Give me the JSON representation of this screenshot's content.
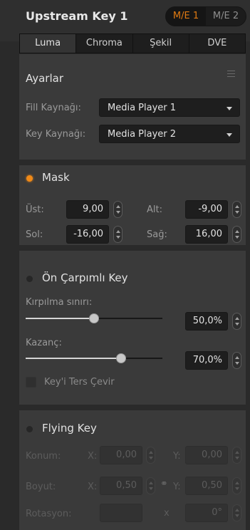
{
  "header": {
    "title": "Upstream Key 1",
    "me_buttons": [
      {
        "label": "M/E 1",
        "active": true
      },
      {
        "label": "M/E 2",
        "active": false
      }
    ]
  },
  "tabs": [
    "Luma",
    "Chroma",
    "Şekil",
    "DVE"
  ],
  "active_tab": "Luma",
  "settings": {
    "heading": "Ayarlar",
    "fill_label": "Fill Kaynağı:",
    "fill_value": "Media Player 1",
    "key_label": "Key Kaynağı:",
    "key_value": "Media Player 2"
  },
  "mask": {
    "heading": "Mask",
    "enabled": true,
    "top_label": "Üst:",
    "top_value": "9,00",
    "bottom_label": "Alt:",
    "bottom_value": "-9,00",
    "left_label": "Sol:",
    "left_value": "-16,00",
    "right_label": "Sağ:",
    "right_value": "16,00"
  },
  "premultiplied": {
    "heading": "Ön Çarpımlı Key",
    "enabled": false,
    "clip_label": "Kırpılma sınırı:",
    "clip_value": "50,0%",
    "clip_level": 0.5,
    "gain_label": "Kazanç:",
    "gain_value": "70,0%",
    "gain_level": 0.7,
    "invert_label": "Key'i Ters Çevir",
    "invert_checked": false
  },
  "flying_key": {
    "heading": "Flying Key",
    "enabled": false,
    "position_label": "Konum:",
    "x_label": "X:",
    "y_label": "Y:",
    "pos_x": "0,00",
    "pos_y": "0,00",
    "size_label": "Boyut:",
    "size_x": "0,50",
    "size_y": "0,50",
    "rotation_label": "Rotasyon:",
    "rotation_x_label": "x",
    "rotation_value": "0°"
  },
  "colors": {
    "accent": "#e07a12",
    "indicator_on": "#f08a18"
  }
}
